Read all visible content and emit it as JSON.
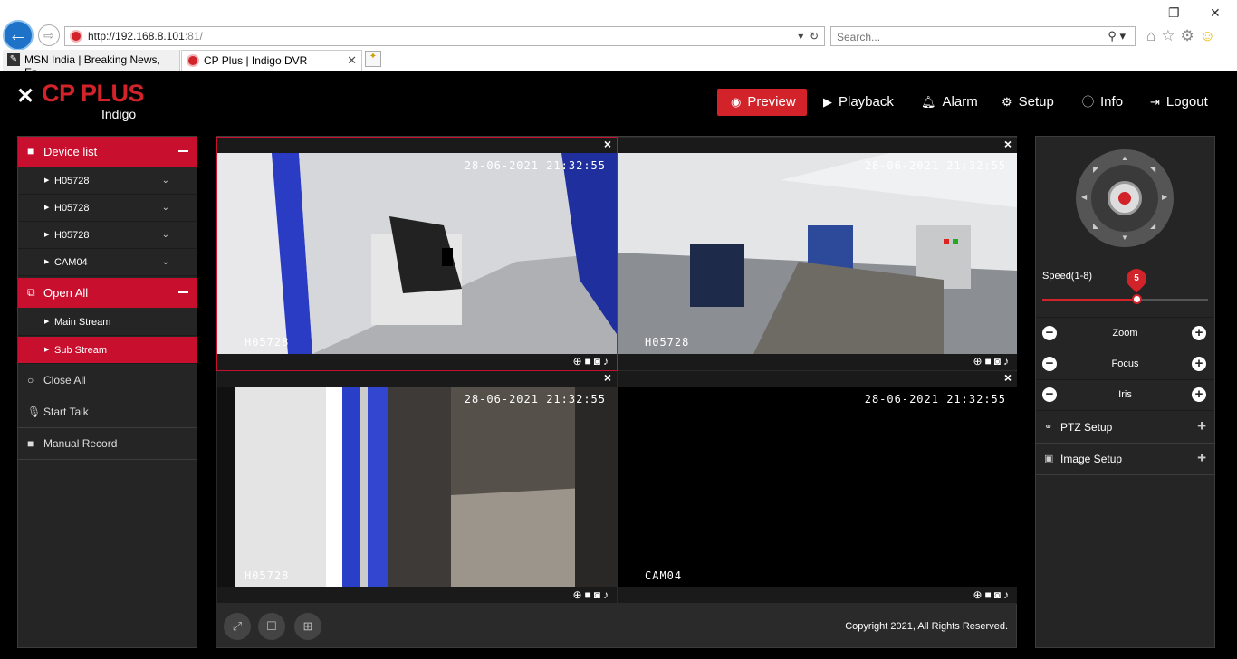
{
  "browser": {
    "url_host": "http://192.168.8.101",
    "url_port": ":81/",
    "search_placeholder": "Search...",
    "tabs": [
      {
        "title": "MSN India | Breaking News, En..."
      },
      {
        "title": "CP Plus | Indigo DVR"
      }
    ]
  },
  "app": {
    "brand": "CP PLUS",
    "sub_brand": "Indigo",
    "nav": [
      {
        "label": "Preview",
        "icon": "eye-icon"
      },
      {
        "label": "Playback",
        "icon": "play-circle-icon"
      },
      {
        "label": "Alarm",
        "icon": "bell-icon"
      },
      {
        "label": "Setup",
        "icon": "gear-icon"
      },
      {
        "label": "Info",
        "icon": "info-icon"
      },
      {
        "label": "Logout",
        "icon": "logout-icon"
      }
    ],
    "active_nav": "Preview"
  },
  "left_panel": {
    "device_list_label": "Device list",
    "devices": [
      "H05728",
      "H05728",
      "H05728",
      "CAM04"
    ],
    "open_all_label": "Open All",
    "streams": [
      "Main Stream",
      "Sub Stream"
    ],
    "selected_stream": "Sub Stream",
    "close_all_label": "Close All",
    "start_talk_label": "Start Talk",
    "manual_record_label": "Manual Record"
  },
  "video": {
    "panes": [
      {
        "timestamp": "28-06-2021 21:32:55",
        "channel": "H05728"
      },
      {
        "timestamp": "28-06-2021 21:32:55",
        "channel": "H05728"
      },
      {
        "timestamp": "28-06-2021 21:32:55",
        "channel": "H05728"
      },
      {
        "timestamp": "28-06-2021 21:32:55",
        "channel": "CAM04"
      }
    ],
    "copyright": "Copyright 2021, All Rights Reserved."
  },
  "right_panel": {
    "speed_label": "Speed(1-8)",
    "speed_value": "5",
    "speed_fraction": 0.57,
    "controls": [
      "Zoom",
      "Focus",
      "Iris"
    ],
    "ptz_setup_label": "PTZ Setup",
    "image_setup_label": "Image Setup"
  },
  "colors": {
    "accent": "#c8102e",
    "panel": "#252525",
    "background": "#000000"
  }
}
